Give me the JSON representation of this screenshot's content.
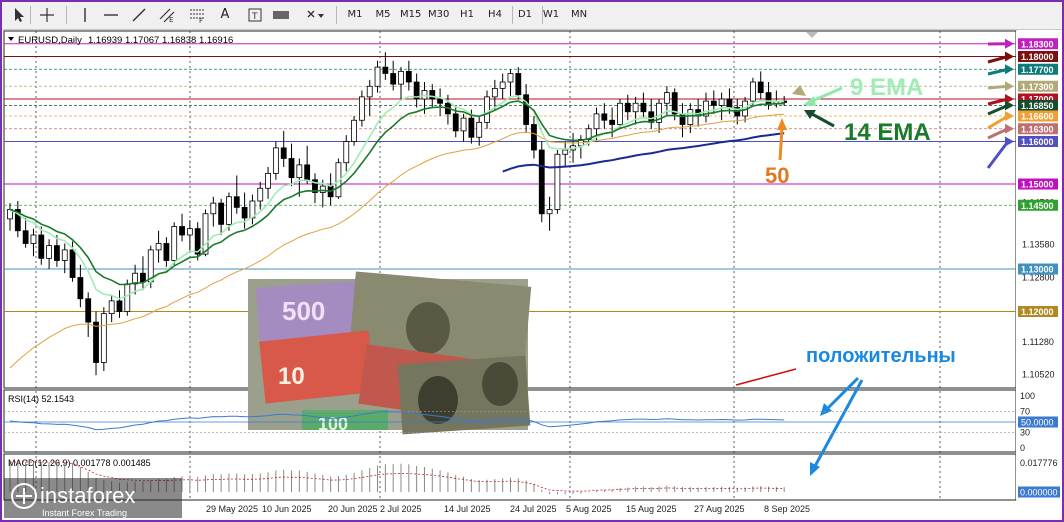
{
  "toolbar": {
    "tools": [
      "cursor-tool",
      "crosshair-tool",
      "vertical-line-tool",
      "horizontal-line-tool",
      "trendline-tool",
      "equidistant-channel-tool",
      "fibonacci-tool",
      "text-tool",
      "text-label-tool",
      "rectangle-tool",
      "arrow-tools-dropdown"
    ],
    "text_tool_label": "A",
    "timeframes": [
      "M1",
      "M5",
      "M15",
      "M30",
      "H1",
      "H4",
      "D1",
      "W1",
      "MN"
    ]
  },
  "chart_data": {
    "type": "candlestick",
    "header": {
      "symbol": "EURUSD,Daily",
      "open": "1.16939",
      "high": "1.17067",
      "low": "1.16838",
      "close": "1.16916"
    },
    "price_axis": {
      "ticks": [
        "1.14560",
        "1.13580",
        "1.12800",
        "1.11280",
        "1.10520"
      ],
      "range": [
        1.102,
        1.186
      ]
    },
    "price_levels": [
      {
        "value": "1.18300",
        "color": "#c020c0"
      },
      {
        "value": "1.18000",
        "color": "#7a1010"
      },
      {
        "value": "1.17700",
        "color": "#0e7a7a"
      },
      {
        "value": "1.17300",
        "color": "#b0aa78"
      },
      {
        "value": "1.17000",
        "color": "#b01020"
      },
      {
        "value": "1.16850",
        "color": "#154d2e"
      },
      {
        "value": "1.16600",
        "color": "#f0a030"
      },
      {
        "value": "1.16300",
        "color": "#c07070"
      },
      {
        "value": "1.16000",
        "color": "#5050c0"
      },
      {
        "value": "1.15000",
        "color": "#c010c0"
      },
      {
        "value": "1.14500",
        "color": "#30a030"
      },
      {
        "value": "1.13000",
        "color": "#4090c0"
      },
      {
        "value": "1.12000",
        "color": "#b08a20"
      }
    ],
    "time_axis": [
      "29 May 2025",
      "10 Jun 2025",
      "20 Jun 2025",
      "2 Jul 2025",
      "14 Jul 2025",
      "24 Jul 2025",
      "5 Aug 2025",
      "15 Aug 2025",
      "27 Aug 2025",
      "8 Sep 2025"
    ],
    "candles": [
      [
        1.1418,
        1.1455,
        1.139,
        1.144
      ],
      [
        1.144,
        1.146,
        1.1375,
        1.139
      ],
      [
        1.139,
        1.142,
        1.135,
        1.136
      ],
      [
        1.136,
        1.1395,
        1.133,
        1.138
      ],
      [
        1.138,
        1.14,
        1.131,
        1.1325
      ],
      [
        1.1325,
        1.137,
        1.13,
        1.1355
      ],
      [
        1.1355,
        1.138,
        1.1305,
        1.132
      ],
      [
        1.132,
        1.136,
        1.129,
        1.1345
      ],
      [
        1.1345,
        1.1365,
        1.127,
        1.128
      ],
      [
        1.128,
        1.131,
        1.121,
        1.123
      ],
      [
        1.123,
        1.1245,
        1.114,
        1.1175
      ],
      [
        1.1175,
        1.12,
        1.105,
        1.108
      ],
      [
        1.108,
        1.121,
        1.106,
        1.1195
      ],
      [
        1.1195,
        1.124,
        1.1175,
        1.1225
      ],
      [
        1.1225,
        1.125,
        1.1185,
        1.12
      ],
      [
        1.12,
        1.1275,
        1.119,
        1.1265
      ],
      [
        1.1265,
        1.131,
        1.124,
        1.129
      ],
      [
        1.129,
        1.133,
        1.125,
        1.127
      ],
      [
        1.127,
        1.1355,
        1.1255,
        1.1345
      ],
      [
        1.1345,
        1.139,
        1.1315,
        1.136
      ],
      [
        1.136,
        1.1375,
        1.1305,
        1.132
      ],
      [
        1.132,
        1.141,
        1.131,
        1.14
      ],
      [
        1.14,
        1.143,
        1.1365,
        1.138
      ],
      [
        1.138,
        1.1415,
        1.134,
        1.1395
      ],
      [
        1.1395,
        1.141,
        1.132,
        1.1335
      ],
      [
        1.1335,
        1.144,
        1.133,
        1.143
      ],
      [
        1.143,
        1.147,
        1.14,
        1.1455
      ],
      [
        1.1455,
        1.1465,
        1.138,
        1.1405
      ],
      [
        1.1405,
        1.148,
        1.139,
        1.147
      ],
      [
        1.147,
        1.152,
        1.143,
        1.1445
      ],
      [
        1.1445,
        1.148,
        1.1395,
        1.142
      ],
      [
        1.142,
        1.1475,
        1.1405,
        1.146
      ],
      [
        1.146,
        1.1505,
        1.144,
        1.149
      ],
      [
        1.149,
        1.154,
        1.1465,
        1.1525
      ],
      [
        1.1525,
        1.16,
        1.151,
        1.1585
      ],
      [
        1.1585,
        1.1625,
        1.154,
        1.156
      ],
      [
        1.156,
        1.1595,
        1.1495,
        1.1515
      ],
      [
        1.1515,
        1.156,
        1.147,
        1.1545
      ],
      [
        1.1545,
        1.159,
        1.15,
        1.151
      ],
      [
        1.151,
        1.1525,
        1.1455,
        1.148
      ],
      [
        1.148,
        1.151,
        1.1445,
        1.1495
      ],
      [
        1.1495,
        1.1525,
        1.145,
        1.147
      ],
      [
        1.147,
        1.156,
        1.1465,
        1.155
      ],
      [
        1.155,
        1.1615,
        1.153,
        1.16
      ],
      [
        1.16,
        1.166,
        1.159,
        1.165
      ],
      [
        1.165,
        1.172,
        1.1635,
        1.1705
      ],
      [
        1.1705,
        1.1745,
        1.166,
        1.173
      ],
      [
        1.173,
        1.179,
        1.1715,
        1.1775
      ],
      [
        1.1775,
        1.181,
        1.1745,
        1.176
      ],
      [
        1.176,
        1.179,
        1.172,
        1.1735
      ],
      [
        1.1735,
        1.1775,
        1.17,
        1.1765
      ],
      [
        1.1765,
        1.179,
        1.172,
        1.174
      ],
      [
        1.174,
        1.176,
        1.168,
        1.17
      ],
      [
        1.17,
        1.174,
        1.1665,
        1.172
      ],
      [
        1.172,
        1.1735,
        1.168,
        1.17
      ],
      [
        1.17,
        1.1725,
        1.166,
        1.169
      ],
      [
        1.169,
        1.171,
        1.164,
        1.1665
      ],
      [
        1.1665,
        1.168,
        1.161,
        1.1625
      ],
      [
        1.1625,
        1.1665,
        1.16,
        1.1655
      ],
      [
        1.1655,
        1.1675,
        1.1595,
        1.161
      ],
      [
        1.161,
        1.166,
        1.159,
        1.1645
      ],
      [
        1.1645,
        1.172,
        1.163,
        1.1705
      ],
      [
        1.1705,
        1.1745,
        1.1675,
        1.1725
      ],
      [
        1.1725,
        1.176,
        1.17,
        1.174
      ],
      [
        1.174,
        1.177,
        1.1705,
        1.176
      ],
      [
        1.176,
        1.1775,
        1.17,
        1.171
      ],
      [
        1.171,
        1.1735,
        1.162,
        1.164
      ],
      [
        1.164,
        1.166,
        1.156,
        1.158
      ],
      [
        1.158,
        1.16,
        1.141,
        1.143
      ],
      [
        1.143,
        1.147,
        1.139,
        1.144
      ],
      [
        1.144,
        1.158,
        1.143,
        1.157
      ],
      [
        1.157,
        1.16,
        1.154,
        1.158
      ],
      [
        1.158,
        1.162,
        1.155,
        1.159
      ],
      [
        1.159,
        1.1615,
        1.156,
        1.1605
      ],
      [
        1.1605,
        1.164,
        1.159,
        1.163
      ],
      [
        1.163,
        1.168,
        1.16,
        1.1665
      ],
      [
        1.1665,
        1.169,
        1.163,
        1.165
      ],
      [
        1.165,
        1.168,
        1.161,
        1.164
      ],
      [
        1.164,
        1.17,
        1.163,
        1.169
      ],
      [
        1.169,
        1.171,
        1.165,
        1.167
      ],
      [
        1.167,
        1.1705,
        1.164,
        1.169
      ],
      [
        1.169,
        1.1715,
        1.1655,
        1.167
      ],
      [
        1.167,
        1.17,
        1.163,
        1.1645
      ],
      [
        1.1645,
        1.17,
        1.162,
        1.169
      ],
      [
        1.169,
        1.173,
        1.166,
        1.1715
      ],
      [
        1.1715,
        1.1725,
        1.165,
        1.1665
      ],
      [
        1.1665,
        1.169,
        1.161,
        1.164
      ],
      [
        1.164,
        1.169,
        1.162,
        1.1675
      ],
      [
        1.1675,
        1.17,
        1.1635,
        1.166
      ],
      [
        1.166,
        1.1715,
        1.1645,
        1.1695
      ],
      [
        1.1695,
        1.172,
        1.1665,
        1.1685
      ],
      [
        1.1685,
        1.1715,
        1.165,
        1.17
      ],
      [
        1.17,
        1.1725,
        1.1665,
        1.168
      ],
      [
        1.168,
        1.17,
        1.164,
        1.166
      ],
      [
        1.166,
        1.1705,
        1.1645,
        1.1695
      ],
      [
        1.1695,
        1.175,
        1.1685,
        1.174
      ],
      [
        1.174,
        1.1765,
        1.17,
        1.1715
      ],
      [
        1.1715,
        1.174,
        1.1675,
        1.169
      ],
      [
        1.169,
        1.172,
        1.168,
        1.1695
      ],
      [
        1.1695,
        1.1707,
        1.1684,
        1.1692
      ]
    ],
    "indicators": [
      {
        "label": "9 EMA",
        "color": "#a0ecb4"
      },
      {
        "label": "14 EMA",
        "color": "#1a7a2a"
      },
      {
        "label": "50",
        "color": "#e07a20"
      }
    ],
    "rsi": {
      "label": "RSI(14) 52.1543",
      "ticks": [
        "100",
        "70",
        "50.0000",
        "30",
        "0"
      ]
    },
    "macd": {
      "label": "MACD(12,26,9) 0.001778 0.001485",
      "ticks": [
        "0.017776",
        "0.000000"
      ]
    },
    "annotation": "положительны"
  },
  "watermark": {
    "brand": "instaforex",
    "tagline": "Instant Forex Trading"
  }
}
